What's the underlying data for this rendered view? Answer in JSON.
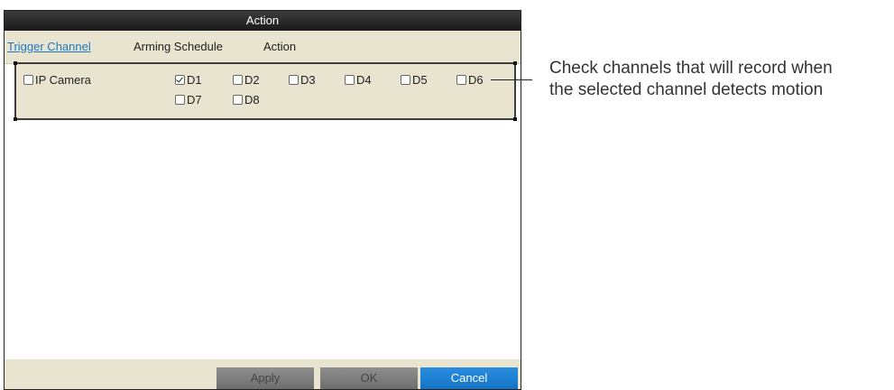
{
  "dialog": {
    "title": "Action",
    "tabs": [
      {
        "label": "Trigger Channel",
        "active": true
      },
      {
        "label": "Arming Schedule",
        "active": false
      },
      {
        "label": "Action",
        "active": false
      }
    ],
    "channels": {
      "ip_camera": {
        "label": "IP Camera",
        "checked": false
      },
      "items": [
        {
          "label": "D1",
          "checked": true
        },
        {
          "label": "D2",
          "checked": false
        },
        {
          "label": "D3",
          "checked": false
        },
        {
          "label": "D4",
          "checked": false
        },
        {
          "label": "D5",
          "checked": false
        },
        {
          "label": "D6",
          "checked": false
        },
        {
          "label": "D7",
          "checked": false
        },
        {
          "label": "D8",
          "checked": false
        }
      ]
    },
    "buttons": {
      "apply": "Apply",
      "ok": "OK",
      "cancel": "Cancel"
    }
  },
  "callout": {
    "line1": "Check channels that will record when",
    "line2": "the selected channel detects motion"
  }
}
